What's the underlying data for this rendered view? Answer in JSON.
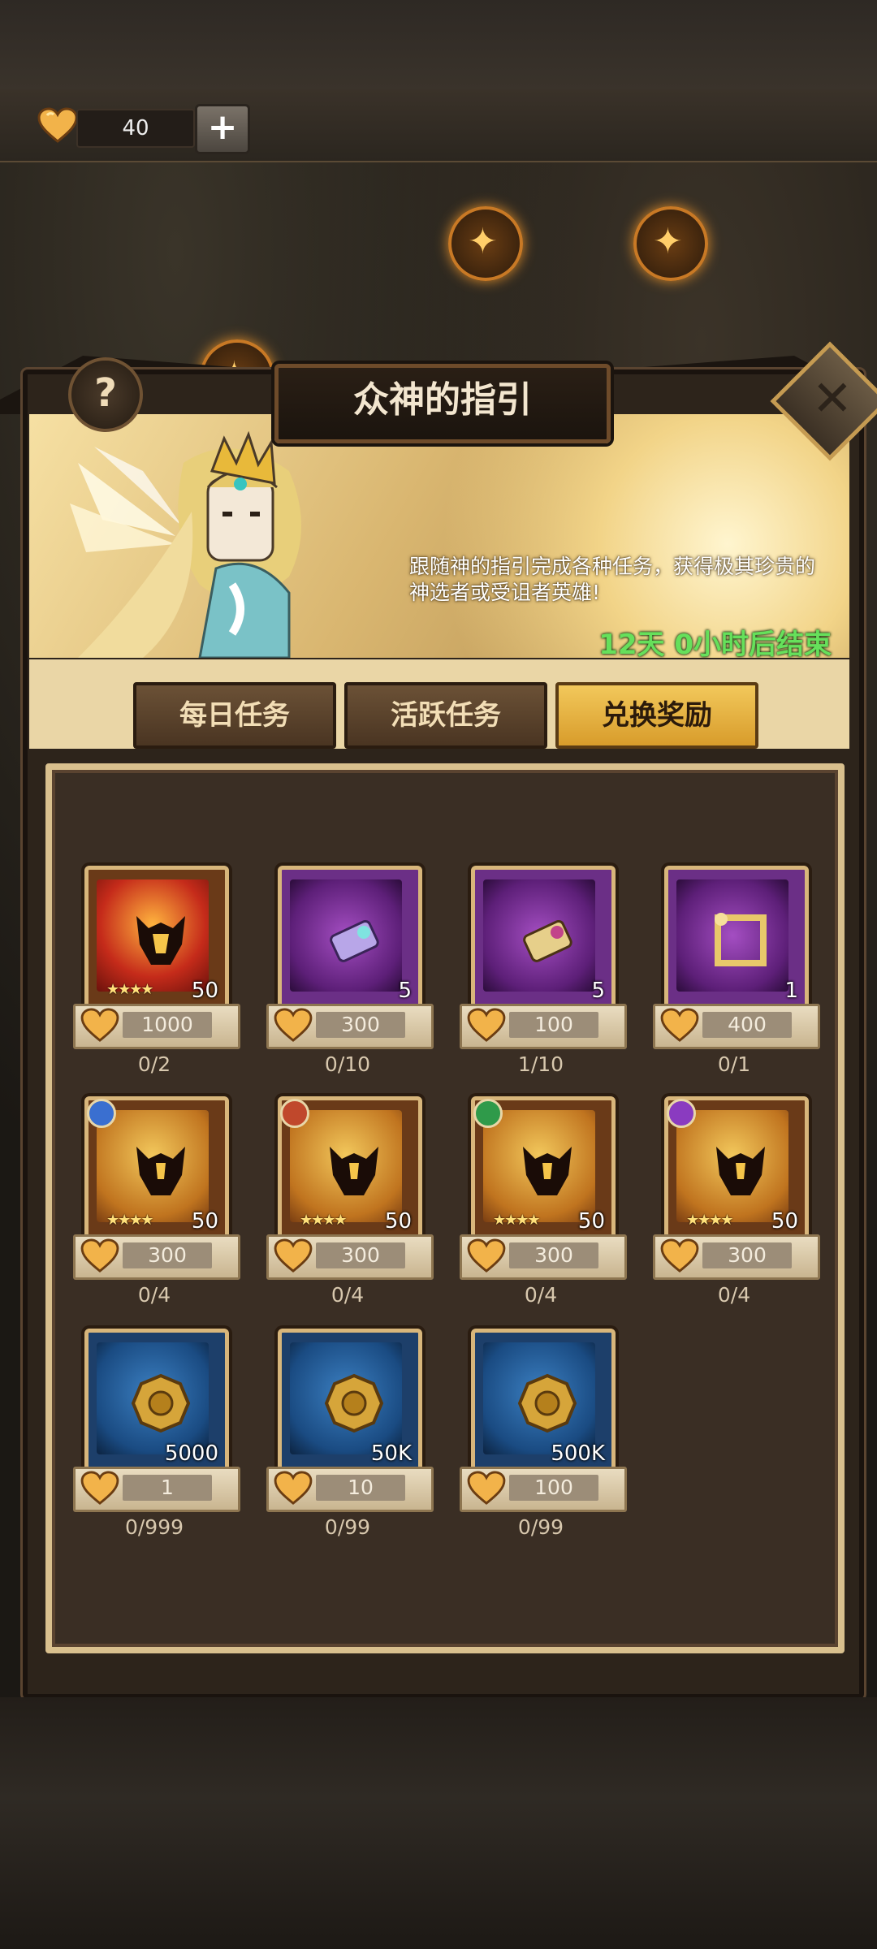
{
  "currency": {
    "value": "40"
  },
  "header": {
    "title": "众神的指引",
    "help": "?",
    "close": "✕"
  },
  "banner": {
    "description": "跟随神的指引完成各种任务，获得极其珍贵的神选者或受诅者英雄!",
    "timer": "12天 0小时后结束"
  },
  "tabs": [
    {
      "label": "每日任务",
      "active": false
    },
    {
      "label": "活跃任务",
      "active": false
    },
    {
      "label": "兑换奖励",
      "active": true
    }
  ],
  "rewards": [
    {
      "qty": "50",
      "price": "1000",
      "progress": "0/2",
      "stars": "★★★★"
    },
    {
      "qty": "5",
      "price": "300",
      "progress": "0/10"
    },
    {
      "qty": "5",
      "price": "100",
      "progress": "1/10"
    },
    {
      "qty": "1",
      "price": "400",
      "progress": "0/1"
    },
    {
      "qty": "50",
      "price": "300",
      "progress": "0/4",
      "stars": "★★★★"
    },
    {
      "qty": "50",
      "price": "300",
      "progress": "0/4",
      "stars": "★★★★"
    },
    {
      "qty": "50",
      "price": "300",
      "progress": "0/4",
      "stars": "★★★★"
    },
    {
      "qty": "50",
      "price": "300",
      "progress": "0/4",
      "stars": "★★★★"
    },
    {
      "qty": "5000",
      "price": "1",
      "progress": "0/999"
    },
    {
      "qty": "50K",
      "price": "10",
      "progress": "0/99"
    },
    {
      "qty": "500K",
      "price": "100",
      "progress": "0/99"
    }
  ]
}
